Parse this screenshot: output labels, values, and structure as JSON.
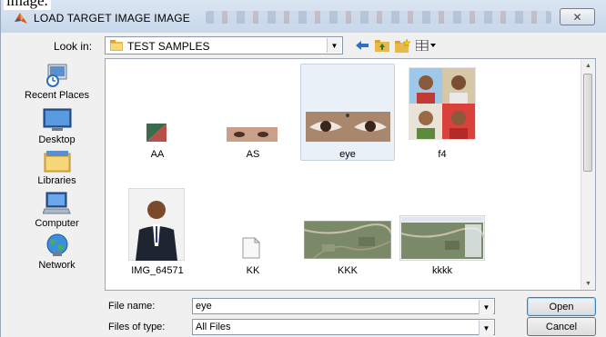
{
  "cropped_text": "image.",
  "window": {
    "title": "LOAD TARGET IMAGE IMAGE",
    "close_glyph": "✕"
  },
  "toolbar": {
    "look_in_label": "Look in:",
    "look_in_value": "TEST SAMPLES",
    "icons": [
      "back-arrow-icon",
      "up-folder-icon",
      "new-folder-icon",
      "view-menu-icon"
    ]
  },
  "places": [
    {
      "label": "Recent Places",
      "icon": "recent-places-icon"
    },
    {
      "label": "Desktop",
      "icon": "desktop-icon"
    },
    {
      "label": "Libraries",
      "icon": "libraries-icon"
    },
    {
      "label": "Computer",
      "icon": "computer-icon"
    },
    {
      "label": "Network",
      "icon": "network-icon"
    }
  ],
  "files": [
    {
      "name": "AA"
    },
    {
      "name": "AS"
    },
    {
      "name": "eye",
      "selected": true
    },
    {
      "name": "f4"
    },
    {
      "name": "IMG_64571"
    },
    {
      "name": "KK"
    },
    {
      "name": "KKK"
    },
    {
      "name": "kkkk"
    }
  ],
  "form": {
    "file_name_label": "File name:",
    "file_name_value": "eye",
    "file_type_label": "Files of type:",
    "file_type_value": "All Files",
    "open_label": "Open",
    "cancel_label": "Cancel"
  },
  "colors": {
    "title_bar": "#c7d7ea",
    "selection": "#eaf0f7",
    "accent": "#3c7fb1"
  }
}
